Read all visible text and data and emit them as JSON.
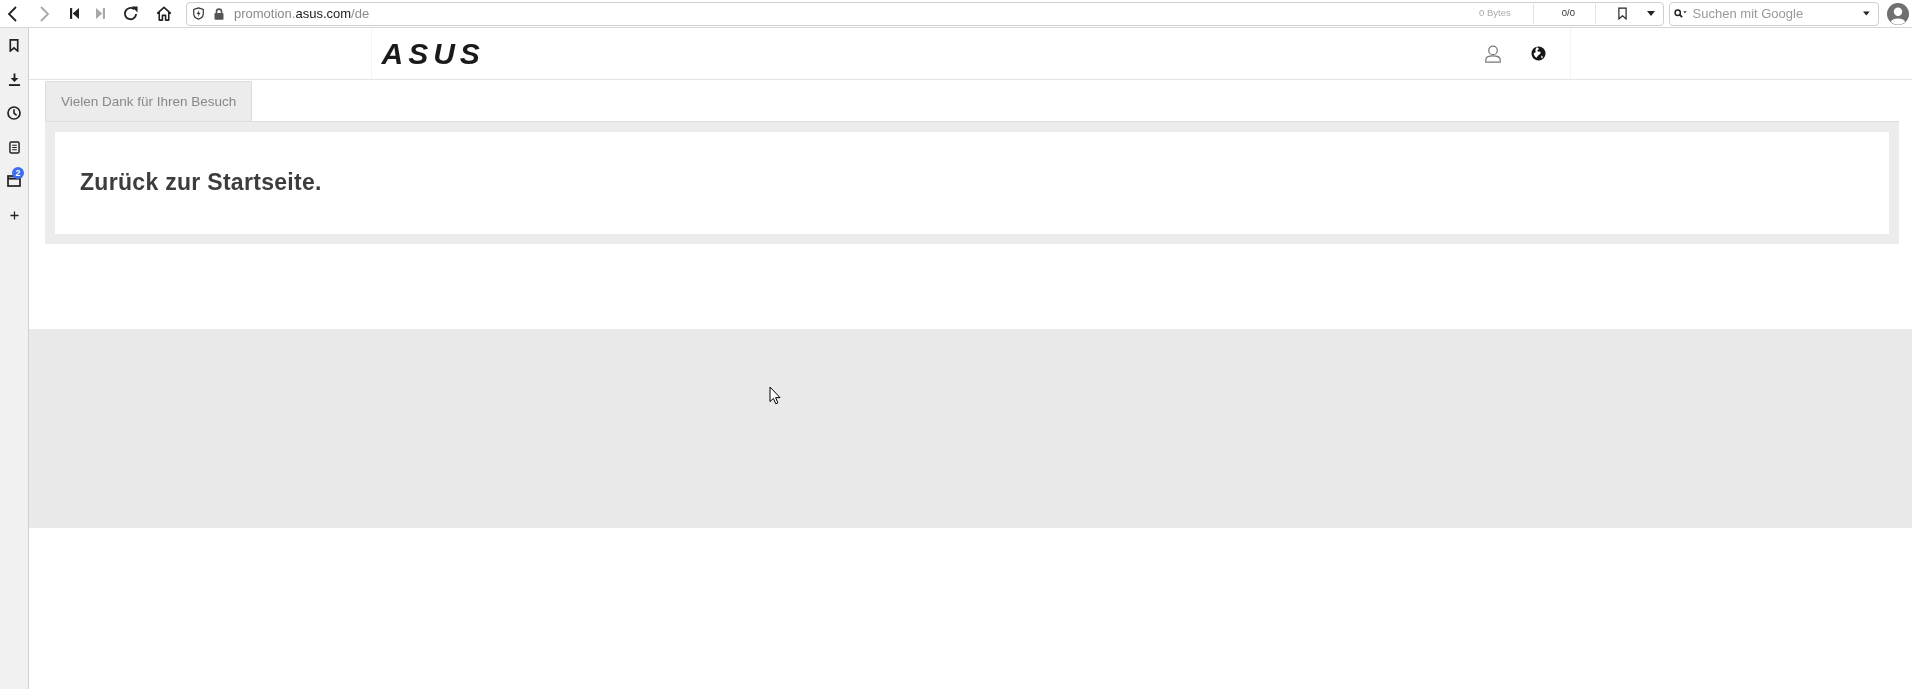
{
  "browser": {
    "nav_buttons": [
      {
        "kind": "back",
        "disabled": false
      },
      {
        "kind": "forward",
        "disabled": true
      },
      {
        "kind": "rewind",
        "disabled": false
      },
      {
        "kind": "fast_forward",
        "disabled": true
      },
      {
        "kind": "reload",
        "disabled": false
      },
      {
        "kind": "home",
        "disabled": false
      }
    ],
    "address": {
      "parts": [
        {
          "text": "promotion.",
          "emphasized": false
        },
        {
          "text": "asus.com",
          "emphasized": true
        },
        {
          "text": "/de",
          "emphasized": false
        }
      ]
    },
    "download_size": "0 Bytes",
    "counter": "0/0",
    "search": {
      "placeholder": "Suchen mit Google"
    }
  },
  "sidebar": {
    "items": [
      {
        "kind": "bookmarks"
      },
      {
        "kind": "downloads"
      },
      {
        "kind": "history"
      },
      {
        "kind": "notes"
      },
      {
        "kind": "windows",
        "badge": "2"
      },
      {
        "kind": "add"
      }
    ]
  },
  "header": {
    "logo": "ASUS"
  },
  "tabs": [
    {
      "label": "Vielen Dank für Ihren Besuch",
      "selected": true
    }
  ],
  "panel": {
    "heading": "Zurück zur Startseite."
  }
}
